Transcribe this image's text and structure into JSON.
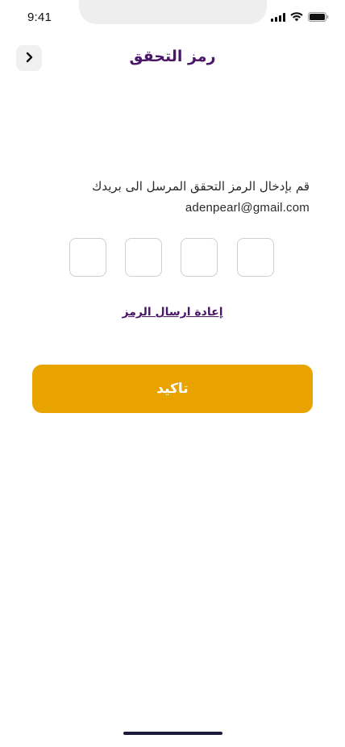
{
  "status_bar": {
    "time": "9:41",
    "icons": [
      "signal-icon",
      "wifi-icon",
      "battery-icon"
    ]
  },
  "header": {
    "title": "رمز التحقق",
    "back_icon": "chevron-left-icon"
  },
  "verification": {
    "instruction": "قم بإدخال الرمز التحقق المرسل الى بريدك",
    "email": "adenpearl@gmail.com",
    "code_digits": [
      "",
      "",
      "",
      ""
    ],
    "resend_label": "إعادة ارسال الرمز",
    "confirm_label": "تاكيد"
  },
  "colors": {
    "title": "#4a1769",
    "accent": "#e9a300",
    "box_border": "#cfcfcf",
    "home_indicator": "#1a1a3a"
  }
}
